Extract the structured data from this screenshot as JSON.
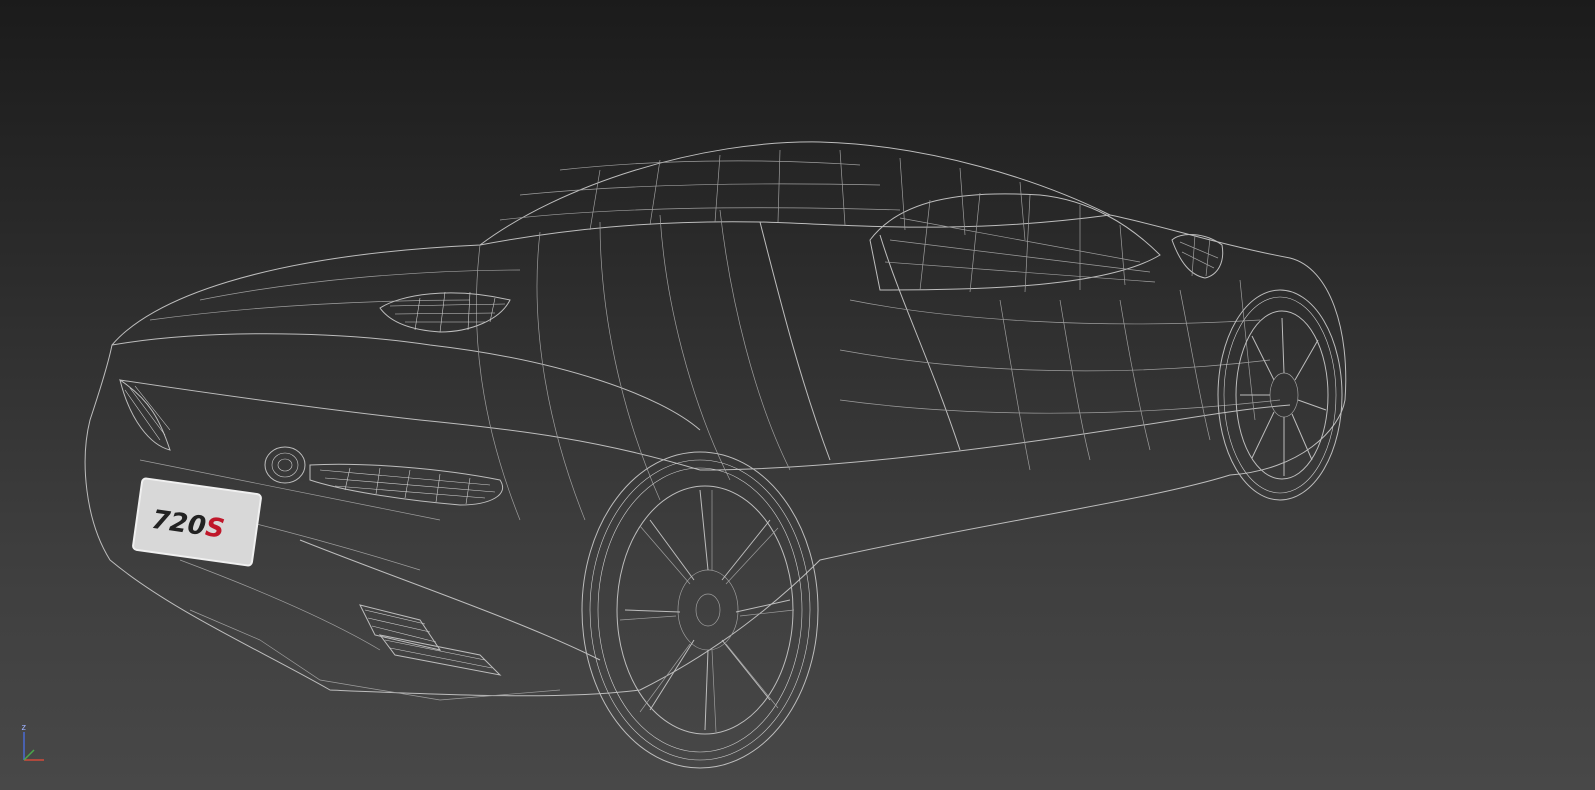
{
  "viewport": {
    "background_top": "#1b1b1b",
    "background_bottom": "#484848",
    "wire_color": "#bdbdbd"
  },
  "model": {
    "badge_prefix": "720",
    "badge_suffix": "S",
    "badge_prefix_color": "#222222",
    "badge_suffix_color": "#c0172a"
  },
  "axis_gizmo": {
    "z_label": "z",
    "x_color": "#d24a3a",
    "y_color": "#4aa84a",
    "z_color": "#4a6ad2"
  }
}
